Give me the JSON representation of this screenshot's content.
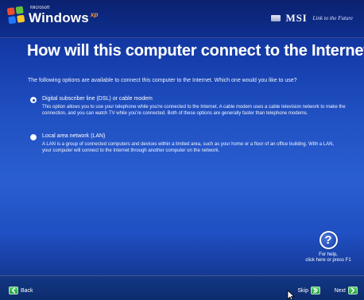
{
  "header": {
    "logo": {
      "small_text": "Microsoft",
      "brand_text": "Windows",
      "superscript": "xp"
    },
    "oem": {
      "brand": "MSI",
      "tagline": "Link to the Future"
    }
  },
  "main": {
    "title": "How will this computer connect to the Internet?",
    "intro": "The following options are available to connect this computer to the Internet. Which one would you like to use?",
    "options": [
      {
        "label": "Digital subscriber line (DSL) or cable modem",
        "description": "This option allows you to use your telephone while you're connected to the Internet. A cable modem uses a cable television network to make the connection, and you can watch TV while you're connected. Both of these options are generally faster than telephone modems.",
        "selected": true
      },
      {
        "label": "Local area network (LAN)",
        "description": "A LAN is a group of connected computers and devices within a limited area, such as your home or a floor of an office building. With a LAN, your computer will connect to the Internet through another computer on the network.",
        "selected": false
      }
    ]
  },
  "help": {
    "line1": "For help,",
    "line2": "click here or press F1"
  },
  "footer": {
    "back_label": "Back",
    "skip_label": "Skip",
    "next_label": "Next"
  },
  "colors": {
    "background_dark": "#0b2d87",
    "background_light": "#2a5fd1",
    "text": "#ffffff",
    "xp_orange": "#ff9d3b",
    "nav_green": "#1f9b39"
  },
  "icons": {
    "logo": "windows-flag-icon",
    "selected_radio": "radio-selected-icon",
    "unselected_radio": "radio-unselected-icon",
    "help": "help-icon",
    "back": "back-arrow-icon",
    "skip": "skip-arrow-icon",
    "next": "next-arrow-icon",
    "cursor": "mouse-pointer-icon"
  }
}
